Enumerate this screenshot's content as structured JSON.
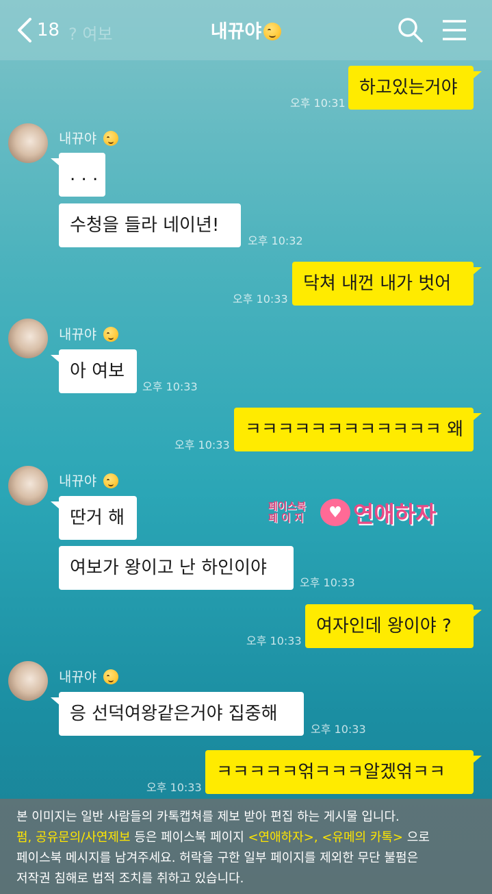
{
  "header": {
    "back_count": "18",
    "ghost_text": "? 여보",
    "title": "내뀨야"
  },
  "messages": [
    {
      "from": "me",
      "text": "하고있는거야",
      "time": "오후 10:31"
    },
    {
      "from": "them",
      "sender": "내뀨야",
      "text": ". . .",
      "time": ""
    },
    {
      "from": "them",
      "text": "수청을 들라 네이년!",
      "time": "오후 10:32"
    },
    {
      "from": "me",
      "text": "닥쳐 내껀 내가 벗어",
      "time": "오후 10:33"
    },
    {
      "from": "them",
      "sender": "내뀨야",
      "text": "아 여보",
      "time": "오후 10:33"
    },
    {
      "from": "me",
      "text": "ㅋㅋㅋㅋㅋㅋㅋㅋㅋㅋㅋㅋ 왜",
      "time": "오후 10:33"
    },
    {
      "from": "them",
      "sender": "내뀨야",
      "text": "딴거 해",
      "time": ""
    },
    {
      "from": "them",
      "text": "여보가 왕이고 난 하인이야",
      "time": "오후 10:33"
    },
    {
      "from": "me",
      "text": "여자인데 왕이야 ?",
      "time": "오후 10:33"
    },
    {
      "from": "them",
      "sender": "내뀨야",
      "text": "응 선덕여왕같은거야 집중해",
      "time": "오후 10:33"
    },
    {
      "from": "me",
      "text": "ㅋㅋㅋㅋㅋ얶ㅋㅋㅋ알겠얶ㅋㅋ",
      "time": "오후 10:33"
    }
  ],
  "watermark": {
    "small_line1": "페이스북",
    "small_line2": "페 이 지",
    "big": "연애하자"
  },
  "footer": {
    "line1": "본 이미지는 일반 사람들의 카톡캡쳐를 제보 받아 편집 하는 게시물 입니다.",
    "line2_hl1": "펌, 공유문의/사연제보",
    "line2_mid": " 등은 페이스북 페이지 ",
    "line2_hl2": "<연애하자>, <유메의 카톡>",
    "line2_end": " 으로",
    "line3": "페이스북 메시지를 남겨주세요. 허락을 구한 일부 페이지를 제외한 무단 불펌은",
    "line4": "저작권 침해로 법적 조치를 취하고 있습니다."
  },
  "colors": {
    "my_bubble": "#ffeb00",
    "their_bubble": "#ffffff",
    "highlight": "#ffe600"
  }
}
